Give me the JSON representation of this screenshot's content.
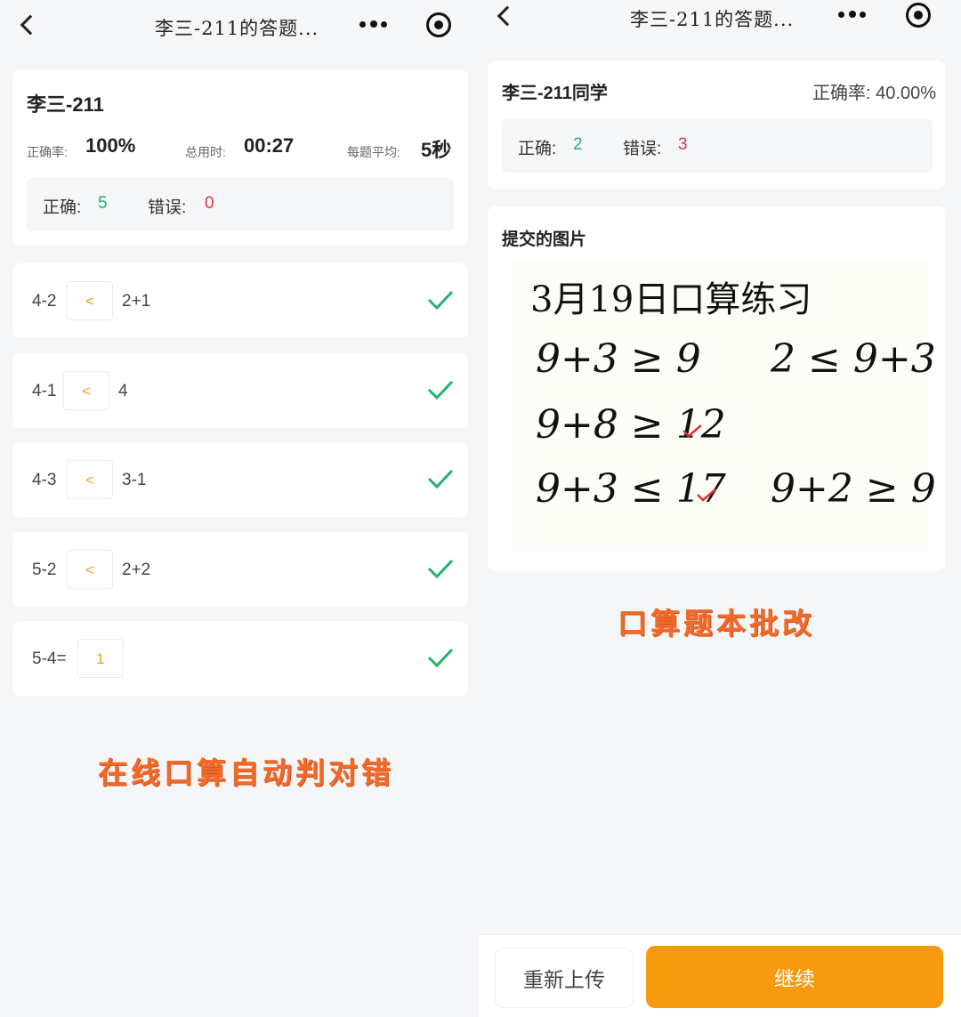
{
  "left": {
    "nav": {
      "title": "李三-211的答题..."
    },
    "summary": {
      "name": "李三-211",
      "accuracy_label": "正确率:",
      "accuracy_value": "100%",
      "time_label": "总用时:",
      "time_value": "00:27",
      "avg_label": "每题平均:",
      "avg_value": "5秒",
      "correct_label": "正确:",
      "correct_count": "5",
      "wrong_label": "错误:",
      "wrong_count": "0"
    },
    "questions": [
      {
        "left": "4-2",
        "answer": "<",
        "right": "2+1"
      },
      {
        "left": "4-1",
        "answer": "<",
        "right": "4"
      },
      {
        "left": "4-3",
        "answer": "<",
        "right": "3-1"
      },
      {
        "left": "5-2",
        "answer": "<",
        "right": "2+2"
      },
      {
        "left": "5-4=",
        "answer": "1",
        "right": ""
      }
    ],
    "caption": "在线口算自动判对错"
  },
  "right": {
    "nav": {
      "title": "李三-211的答题..."
    },
    "summary": {
      "student": "李三-211同学",
      "accuracy_label": "正确率:",
      "accuracy_value": "40.00%",
      "correct_label": "正确:",
      "correct_count": "2",
      "wrong_label": "错误:",
      "wrong_count": "3"
    },
    "image_section": {
      "label": "提交的图片",
      "handwriting": {
        "title": "3月19日口算练习",
        "lines": [
          "9+3 ≥ 9",
          "2 ≤ 9+3",
          "9+8 ≥ 12",
          "9+3 ≤ 17",
          "9+2 ≥ 9"
        ]
      }
    },
    "caption": "口算题本批改",
    "buttons": {
      "reupload": "重新上传",
      "continue": "继续"
    }
  },
  "colors": {
    "correct": "#21b26a",
    "wrong": "#e0304a",
    "accent": "#f79a0f",
    "caption": "#f06a2a"
  },
  "icons": [
    "chevron-left-icon",
    "more-dots-icon",
    "target-icon",
    "checkmark-icon",
    "red-tick-icon"
  ]
}
